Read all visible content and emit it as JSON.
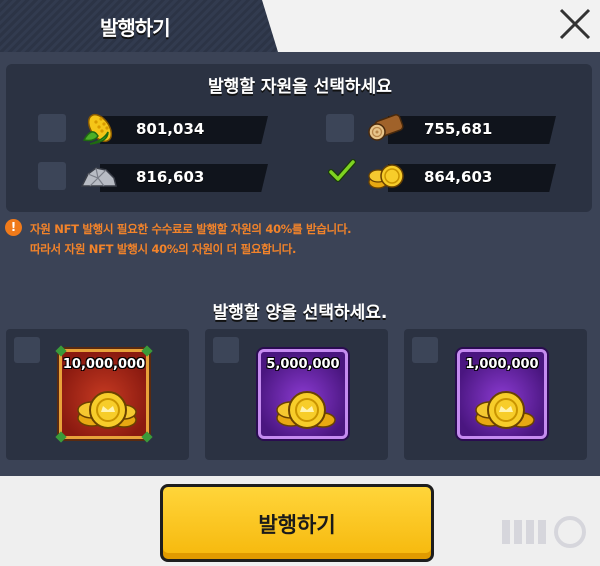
{
  "header": {
    "title": "발행하기"
  },
  "resource_section": {
    "title": "발행할 자원을 선택하세요",
    "items": [
      {
        "icon": "corn-icon",
        "value": "801,034",
        "checked": false
      },
      {
        "icon": "wood-log-icon",
        "value": "755,681",
        "checked": false
      },
      {
        "icon": "stone-icon",
        "value": "816,603",
        "checked": false
      },
      {
        "icon": "gold-coins-icon",
        "value": "864,603",
        "checked": true
      }
    ]
  },
  "notice": {
    "icon": "exclamation-icon",
    "lines": [
      "자원 NFT 발행시 필요한 수수료로 발행할 자원의 40%를 받습니다.",
      "따라서 자원 NFT 발행시 40%의 자원이 더 필요합니다."
    ]
  },
  "amount_section": {
    "title": "발행할 양을 선택하세요.",
    "options": [
      {
        "amount": "10,000,000",
        "frame": "red"
      },
      {
        "amount": "5,000,000",
        "frame": "purple"
      },
      {
        "amount": "1,000,000",
        "frame": "purple"
      }
    ]
  },
  "footer": {
    "issue_button_label": "발행하기"
  },
  "colors": {
    "accent_yellow": "#f6b80c",
    "notice_orange": "#f2832a",
    "check_green": "#7ed321"
  }
}
